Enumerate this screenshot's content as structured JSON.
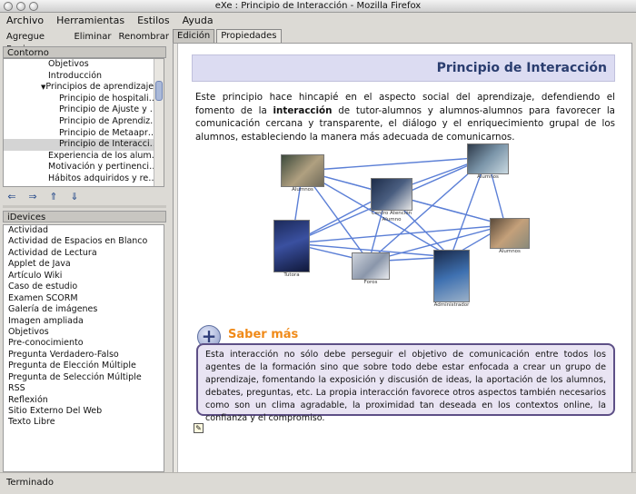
{
  "window": {
    "title": "eXe : Principio de Interacción - Mozilla Firefox"
  },
  "menubar": [
    {
      "label": "Archivo"
    },
    {
      "label": "Herramientas"
    },
    {
      "label": "Estilos"
    },
    {
      "label": "Ayuda"
    }
  ],
  "toolbar": {
    "add_page": "Agregue Pagina",
    "delete": "Eliminar",
    "rename": "Renombrar"
  },
  "tabs": [
    {
      "label": "Edición",
      "active": true
    },
    {
      "label": "Propiedades",
      "active": false
    }
  ],
  "outline": {
    "title": "Contorno",
    "items": [
      {
        "label": "Objetivos",
        "level": 1,
        "selected": false
      },
      {
        "label": "Introducción",
        "level": 1,
        "selected": false
      },
      {
        "label": "Principios de aprendizaje",
        "level": 1,
        "expanded": true,
        "selected": false
      },
      {
        "label": "Principio de hospitali…",
        "level": 2,
        "selected": false
      },
      {
        "label": "Principio de Ajuste y …",
        "level": 2,
        "selected": false
      },
      {
        "label": "Principio de Aprendiz…",
        "level": 2,
        "selected": false
      },
      {
        "label": "Principio de Metaapr…",
        "level": 2,
        "selected": false
      },
      {
        "label": "Principio de Interacci…",
        "level": 2,
        "selected": true
      },
      {
        "label": "Experiencia de los alum…",
        "level": 1,
        "selected": false
      },
      {
        "label": "Motivación y pertinenci…",
        "level": 1,
        "selected": false
      },
      {
        "label": "Hábitos adquiridos y re…",
        "level": 1,
        "selected": false
      }
    ]
  },
  "tree_buttons": [
    {
      "icon": "promote-icon"
    },
    {
      "icon": "demote-icon"
    },
    {
      "icon": "move-up-icon"
    },
    {
      "icon": "move-down-icon"
    }
  ],
  "idevices": {
    "title": "iDevices",
    "items": [
      "Actividad",
      "Actividad de Espacios en Blanco",
      "Actividad de Lectura",
      "Applet de Java",
      "Artículo Wiki",
      "Caso de estudio",
      "Examen SCORM",
      "Galería de imágenes",
      "Imagen ampliada",
      "Objetivos",
      "Pre-conocimiento",
      "Pregunta Verdadero-Falso",
      "Pregunta de Elección Múltiple",
      "Pregunta de Selección Múltiple",
      "RSS",
      "Reflexión",
      "Sitio Externo Del Web",
      "Texto Libre"
    ]
  },
  "page": {
    "title": "Principio de Interacción",
    "intro_before": "Este principio hace hincapié en el aspecto social del aprendizaje, defendiendo el fomento de la ",
    "intro_bold": "interacción",
    "intro_after": " de tutor-alumnos y alumnos-alumnos para favorecer la comunicación cercana y transparente, el diálogo y el enriquecimiento grupal de los alumnos, estableciendo la manera más adecuada de comunicarnos.",
    "diagram_labels": {
      "alumnos_left": "Alumnos",
      "alumnos_top": "Alumnos",
      "centro": "Centro Atención Alumno",
      "alumnos_right": "Alumnos",
      "tutora": "Tutora",
      "foros": "Foros",
      "administrador": "Administrador"
    },
    "saber_title": "Saber más",
    "saber_text": "Esta interacción no sólo debe perseguir el objetivo de comunicación entre todos los agentes de la formación sino que sobre todo debe estar enfocada a crear un grupo de aprendizaje, fomentando la exposición y discusión de ideas, la aportación de los alumnos, debates, preguntas, etc. La propia interacción favorece otros aspectos también necesarios como son un clima agradable, la proximidad tan deseada en los contextos online, la confianza y el compromiso."
  },
  "statusbar": {
    "text": "Terminado"
  },
  "colors": {
    "title_band": "#dcdcf2",
    "title_text": "#2a3d6f",
    "saber_orange": "#f08a18",
    "saber_border": "#5d4f86",
    "network_line": "#5b7fd6"
  }
}
